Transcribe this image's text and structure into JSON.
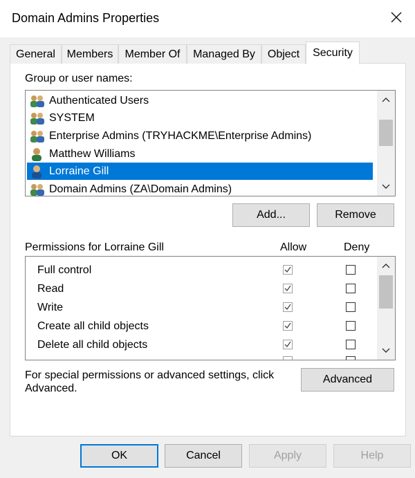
{
  "window": {
    "title": "Domain Admins Properties"
  },
  "tabs": [
    {
      "label": "General"
    },
    {
      "label": "Members"
    },
    {
      "label": "Member Of"
    },
    {
      "label": "Managed By"
    },
    {
      "label": "Object"
    },
    {
      "label": "Security"
    }
  ],
  "active_tab": "Security",
  "group_list": {
    "label": "Group or user names:",
    "items": [
      {
        "name": "Authenticated Users",
        "icon": "group-users-icon"
      },
      {
        "name": "SYSTEM",
        "icon": "group-users-icon"
      },
      {
        "name": "Enterprise Admins (TRYHACKME\\Enterprise Admins)",
        "icon": "group-users-icon"
      },
      {
        "name": "Matthew Williams",
        "icon": "user-icon"
      },
      {
        "name": "Lorraine Gill",
        "icon": "user-icon",
        "selected": true
      },
      {
        "name": "Domain Admins (ZA\\Domain Admins)",
        "icon": "group-users-icon"
      }
    ]
  },
  "buttons": {
    "add": "Add...",
    "remove": "Remove",
    "advanced": "Advanced",
    "ok": "OK",
    "cancel": "Cancel",
    "apply": "Apply",
    "help": "Help"
  },
  "permissions": {
    "label": "Permissions for Lorraine Gill",
    "allow_header": "Allow",
    "deny_header": "Deny",
    "rows": [
      {
        "name": "Full control",
        "allow": true,
        "deny": false
      },
      {
        "name": "Read",
        "allow": true,
        "deny": false
      },
      {
        "name": "Write",
        "allow": true,
        "deny": false
      },
      {
        "name": "Create all child objects",
        "allow": true,
        "deny": false
      },
      {
        "name": "Delete all child objects",
        "allow": true,
        "deny": false
      }
    ]
  },
  "advanced_note": {
    "line1": "For special permissions or advanced settings, click",
    "line2": "Advanced."
  },
  "colors": {
    "selection": "#0078d7",
    "dialog_bg": "#f0f0f0",
    "focus_border": "#0078d7"
  }
}
